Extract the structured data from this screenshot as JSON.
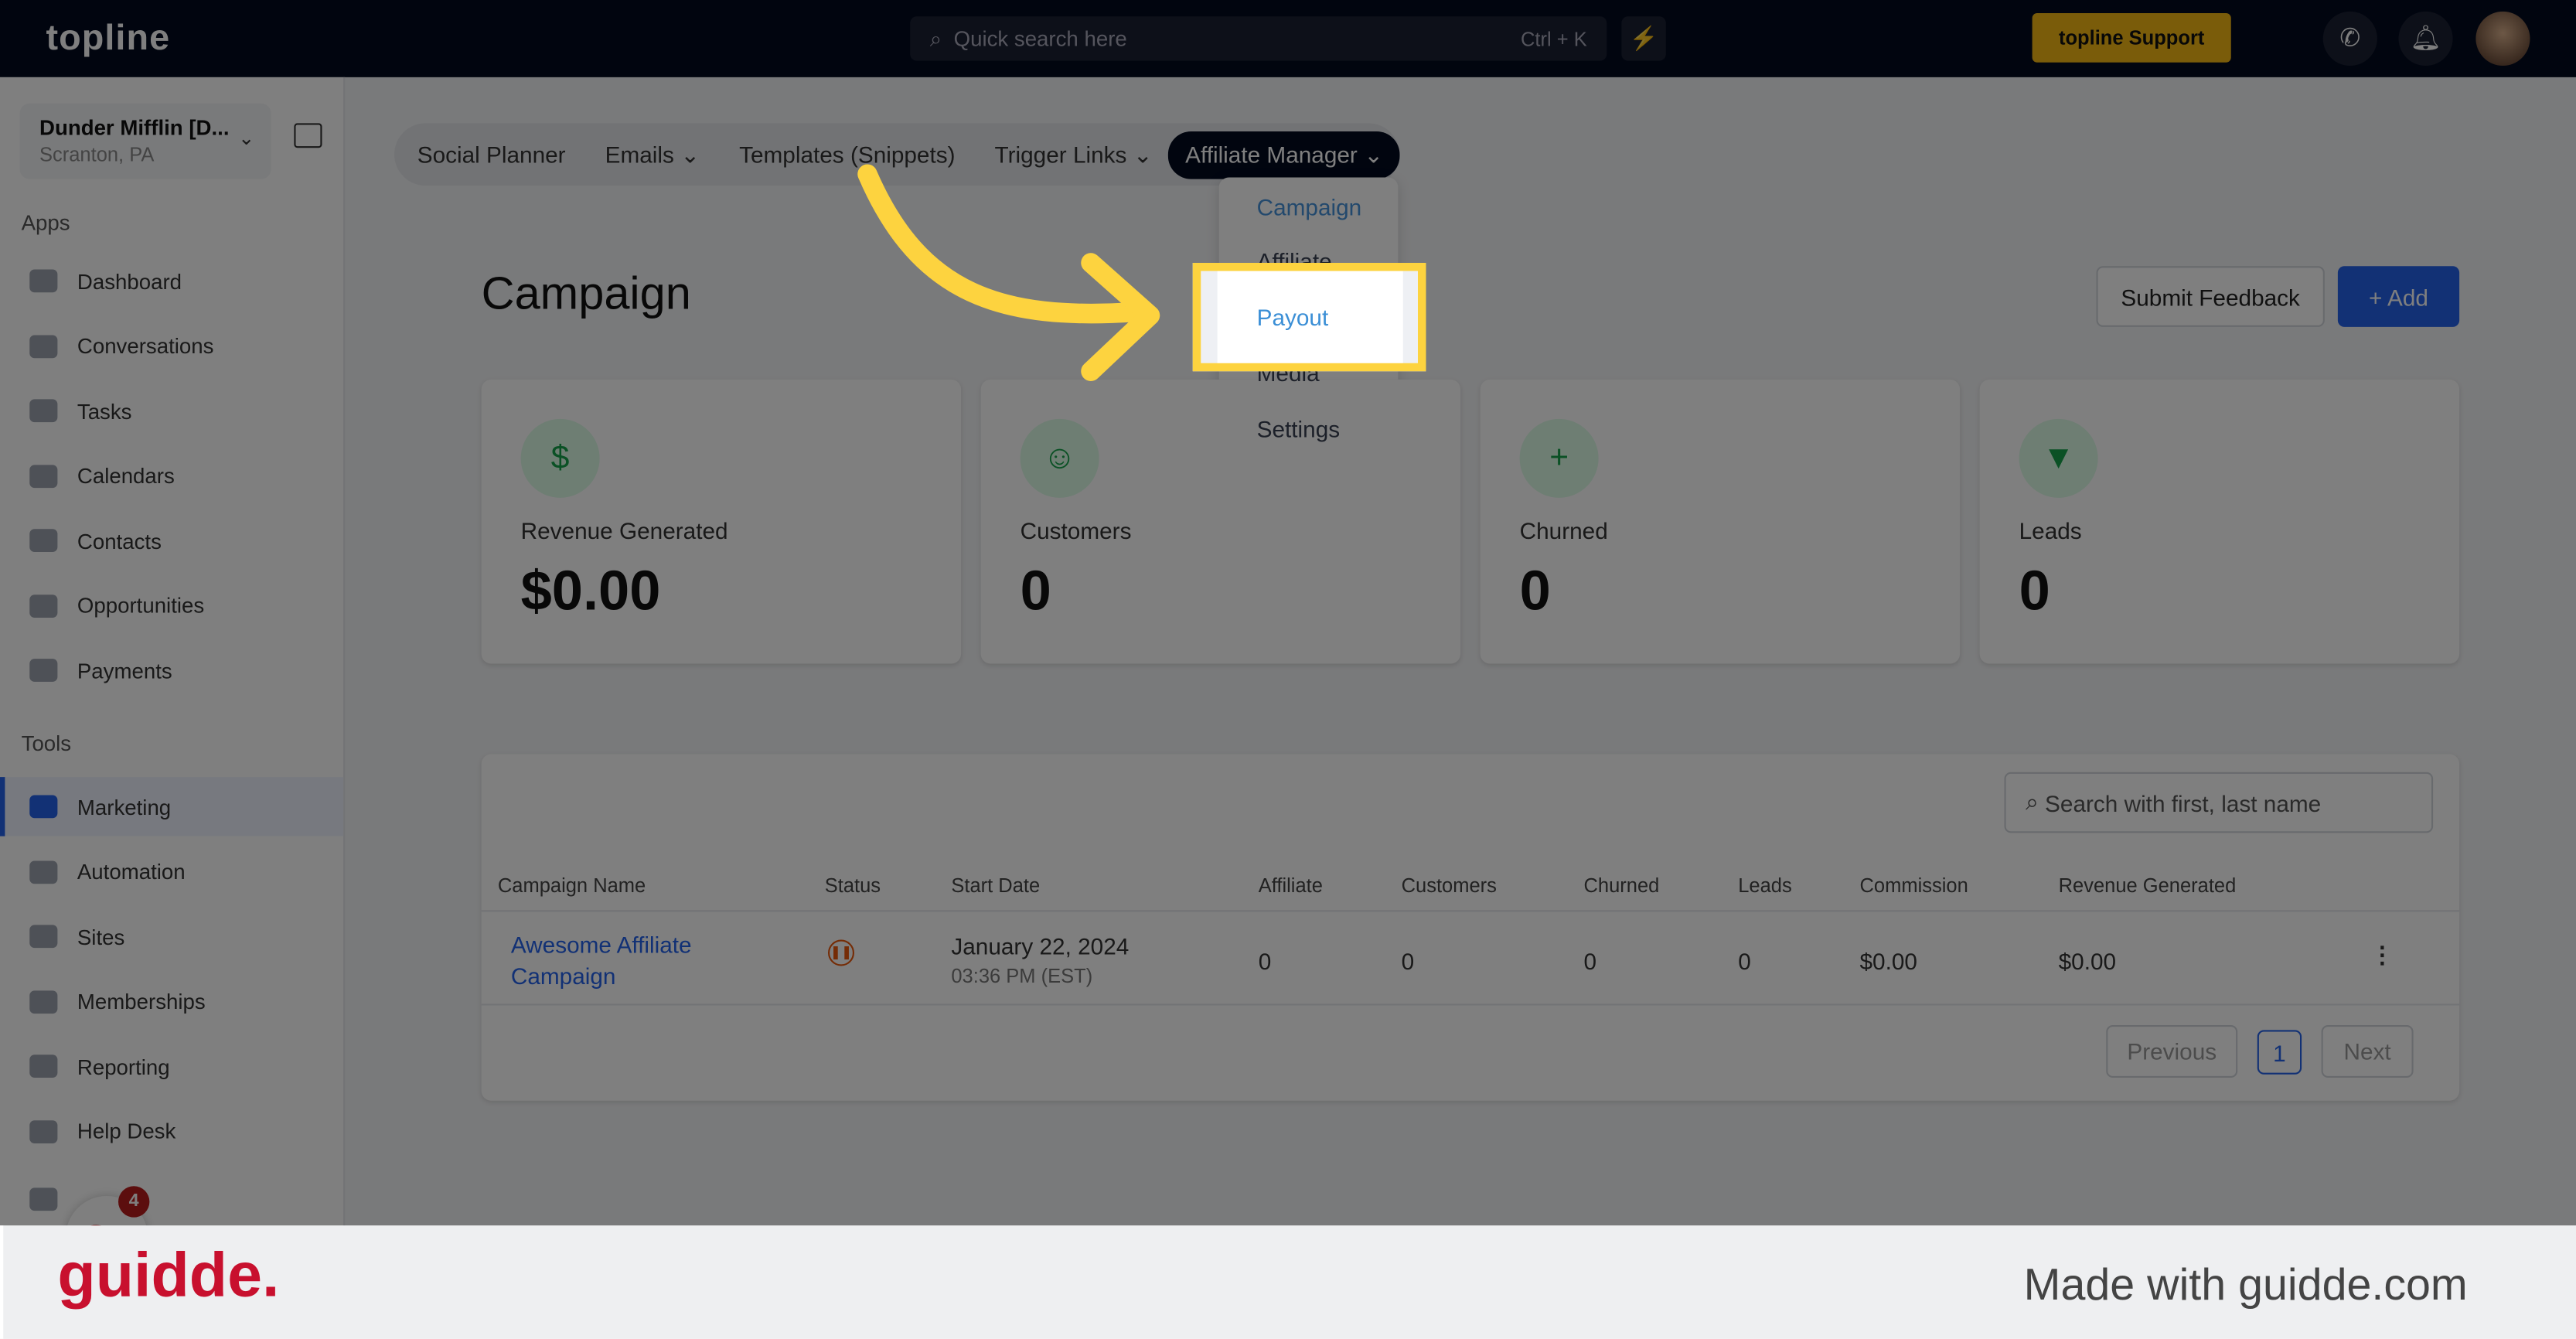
{
  "topbar": {
    "logo": "topline",
    "search_placeholder": "Quick search here",
    "shortcut": "Ctrl + K",
    "support": "topline Support"
  },
  "location": {
    "name": "Dunder Mifflin [D...",
    "city": "Scranton, PA"
  },
  "sidebar": {
    "apps_label": "Apps",
    "tools_label": "Tools",
    "apps": [
      {
        "label": "Dashboard"
      },
      {
        "label": "Conversations"
      },
      {
        "label": "Tasks"
      },
      {
        "label": "Calendars"
      },
      {
        "label": "Contacts"
      },
      {
        "label": "Opportunities"
      },
      {
        "label": "Payments"
      }
    ],
    "tools": [
      {
        "label": "Marketing"
      },
      {
        "label": "Automation"
      },
      {
        "label": "Sites"
      },
      {
        "label": "Memberships"
      },
      {
        "label": "Reporting"
      },
      {
        "label": "Help Desk"
      }
    ],
    "helper_badge": "4"
  },
  "tabs": [
    "Social Planner",
    "Emails",
    "Templates (Snippets)",
    "Trigger Links",
    "Affiliate Manager"
  ],
  "dropdown": [
    "Campaign",
    "Affiliate",
    "Payout",
    "Media",
    "Settings"
  ],
  "page": {
    "title": "Campaign",
    "feedback": "Submit Feedback",
    "add": "+ Add"
  },
  "cards": [
    {
      "label": "Revenue Generated",
      "value": "$0.00",
      "icon": "dollar-icon"
    },
    {
      "label": "Customers",
      "value": "0",
      "icon": "user-icon"
    },
    {
      "label": "Churned",
      "value": "0",
      "icon": "user-plus-icon"
    },
    {
      "label": "Leads",
      "value": "0",
      "icon": "funnel-icon"
    }
  ],
  "table": {
    "search_placeholder": "Search with first, last name",
    "headers": [
      "Campaign Name",
      "Status",
      "Start Date",
      "Affiliate",
      "Customers",
      "Churned",
      "Leads",
      "Commission",
      "Revenue Generated"
    ],
    "row": {
      "name": "Awesome Affiliate Campaign",
      "status": "paused",
      "date": "January 22, 2024",
      "time": "03:36 PM (EST)",
      "affiliate": "0",
      "customers": "0",
      "churned": "0",
      "leads": "0",
      "commission": "$0.00",
      "revenue": "$0.00"
    },
    "pagination": {
      "prev": "Previous",
      "page": "1",
      "next": "Next"
    }
  },
  "highlight": {
    "label": "Payout",
    "color": "#fdd33f"
  },
  "footer": {
    "brand": "guidde.",
    "made": "Made with guidde.com"
  }
}
